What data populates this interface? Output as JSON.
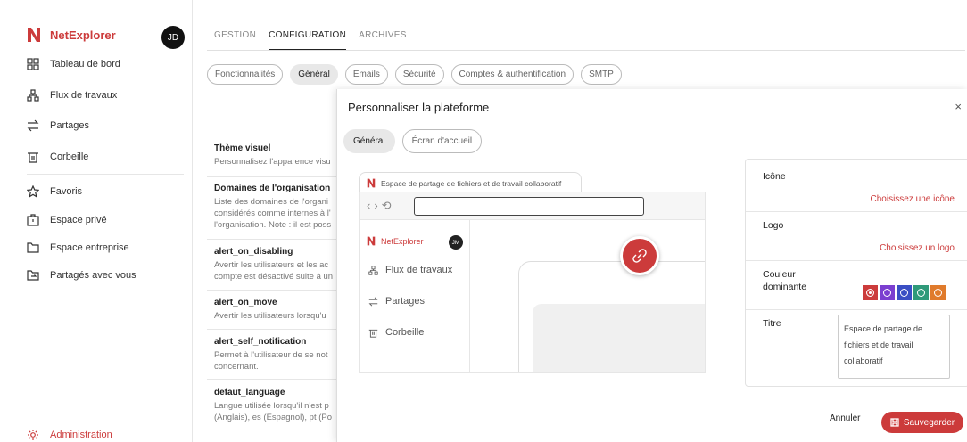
{
  "sidebar": {
    "brand": "NetExplorer",
    "avatar": "JD",
    "items": [
      {
        "label": "Tableau de bord"
      },
      {
        "label": "Flux de travaux"
      },
      {
        "label": "Partages"
      },
      {
        "label": "Corbeille"
      },
      {
        "label": "Favoris"
      },
      {
        "label": "Espace privé"
      },
      {
        "label": "Espace entreprise"
      },
      {
        "label": "Partagés avec vous"
      }
    ],
    "admin": "Administration"
  },
  "top_tabs": [
    "GESTION",
    "CONFIGURATION",
    "ARCHIVES"
  ],
  "pills": [
    "Fonctionnalités",
    "Général",
    "Emails",
    "Sécurité",
    "Comptes & authentification",
    "SMTP"
  ],
  "settings": [
    {
      "title": "Thème visuel",
      "desc": "Personnalisez l'apparence visu"
    },
    {
      "title": "Domaines de l'organisation",
      "desc": "Liste des domaines de l'organi considérés comme internes à l' l'organisation. Note : il est poss"
    },
    {
      "title": "alert_on_disabling",
      "desc": "Avertir les utilisateurs et les ac compte est désactivé suite à un"
    },
    {
      "title": "alert_on_move",
      "desc": "Avertir les utilisateurs lorsqu'u"
    },
    {
      "title": "alert_self_notification",
      "desc": "Permet à l'utilisateur de se not concernant."
    },
    {
      "title": "defaut_language",
      "desc": "Langue utilisée lorsqu'il n'est p (Anglais), es (Espagnol), pt (Po"
    }
  ],
  "modal": {
    "title": "Personnaliser la plateforme",
    "close": "×",
    "tabs": [
      "Général",
      "Écran d'accueil"
    ],
    "preview": {
      "tab_title": "Espace de partage de fichiers et de travail collaboratif",
      "brand": "NetExplorer",
      "avatar": "JM",
      "items": [
        "Flux de travaux",
        "Partages",
        "Corbeille"
      ]
    },
    "panel": {
      "icone_label": "Icône",
      "icone_link": "Choisissez une icône",
      "logo_label": "Logo",
      "logo_link": "Choisissez un logo",
      "couleur_label": "Couleur dominante",
      "titre_label": "Titre",
      "titre_value": "Espace de partage de fichiers et de travail collaboratif",
      "swatches": [
        "#cc3b3b",
        "#7b3fd0",
        "#3a4fc4",
        "#2f9a7a",
        "#e07b2c"
      ],
      "selected_swatch": 0
    },
    "cancel": "Annuler",
    "save": "Sauvegarder"
  },
  "accent": "#cc3b3b"
}
